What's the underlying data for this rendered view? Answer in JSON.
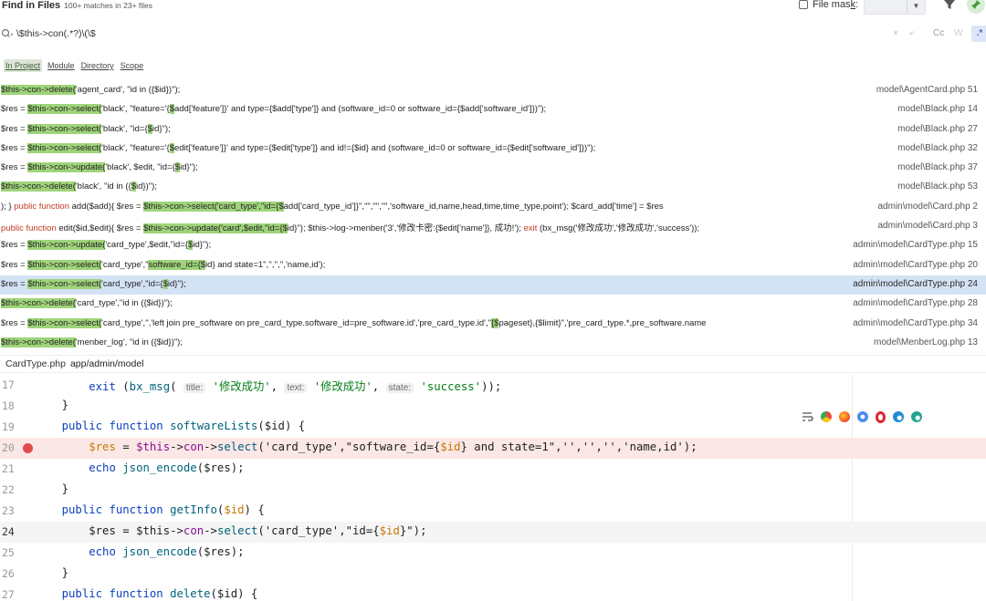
{
  "header": {
    "title": "Find in Files",
    "subtitle": "100+ matches in 23+ files",
    "file_mask_label": "File mas",
    "file_mask_underlined": "k",
    "file_mask_colon": ":"
  },
  "search": {
    "query": "\\$this->con(.*?)\\(\\$",
    "options": [
      "×",
      "⤶",
      "Cc",
      "W"
    ],
    "regex_label": ".*"
  },
  "scopes": [
    "In Project",
    "Module",
    "Directory",
    "Scope"
  ],
  "results": [
    {
      "parts": [
        [
          "hl",
          "$this->con->delete("
        ],
        [
          "",
          "'agent_card', \"id in ({$id})\");"
        ]
      ],
      "file": "model\\AgentCard.php 51"
    },
    {
      "parts": [
        [
          "",
          "$res = "
        ],
        [
          "hl",
          "$this->con->select("
        ],
        [
          "",
          "'black', \"feature='{"
        ],
        [
          "hl",
          "$"
        ],
        [
          "",
          "add['feature']}' and type={$add['type']} and (software_id=0 or software_id={$add['software_id']})\");"
        ]
      ],
      "file": "model\\Black.php 14"
    },
    {
      "parts": [
        [
          "",
          "$res = "
        ],
        [
          "hl",
          "$this->con->select("
        ],
        [
          "",
          "'black', \"id={"
        ],
        [
          "hl",
          "$"
        ],
        [
          "",
          "id}\");"
        ]
      ],
      "file": "model\\Black.php 27"
    },
    {
      "parts": [
        [
          "",
          "$res = "
        ],
        [
          "hl",
          "$this->con->select("
        ],
        [
          "",
          "'black', \"feature='{"
        ],
        [
          "hl",
          "$"
        ],
        [
          "",
          "edit['feature']}' and type={$edit['type']} and id!={$id} and (software_id=0 or software_id={$edit['software_id']})\");"
        ]
      ],
      "file": "model\\Black.php 32"
    },
    {
      "parts": [
        [
          "",
          "$res = "
        ],
        [
          "hl",
          "$this->con->update("
        ],
        [
          "",
          "'black', $edit, \"id={"
        ],
        [
          "hl",
          "$"
        ],
        [
          "",
          "id}\");"
        ]
      ],
      "file": "model\\Black.php 37"
    },
    {
      "parts": [
        [
          "hl",
          "$this->con->delete("
        ],
        [
          "",
          "'black', \"id in ({"
        ],
        [
          "hl",
          "$"
        ],
        [
          "",
          "id})\");"
        ]
      ],
      "file": "model\\Black.php 53"
    },
    {
      "parts": [
        [
          "",
          "); } "
        ],
        [
          "kw",
          "public function "
        ],
        [
          "",
          "add($add){ $res = "
        ],
        [
          "hl",
          "$this->con->select('card_type',\"id={$"
        ],
        [
          "",
          "add['card_type_id']}\",\"\",\"\",\"\",'software_id,name,head,time,time_type,point'); $card_add['time'] = $res"
        ]
      ],
      "file": "admin\\model\\Card.php 2"
    },
    {
      "parts": [
        [
          "kw",
          "public function "
        ],
        [
          "",
          "edit($id,$edit){ $res = "
        ],
        [
          "hl",
          "$this->con->update('card',$edit,\"id={$"
        ],
        [
          "",
          "id}\"); $this->log->menber('3','修改卡密:{$edit['name']}, 成功!'); "
        ],
        [
          "kw",
          "exit "
        ],
        [
          "",
          "(bx_msg('修改成功','修改成功','success'));"
        ]
      ],
      "file": "admin\\model\\Card.php 3"
    },
    {
      "parts": [
        [
          "",
          "$res = "
        ],
        [
          "hl",
          "$this->con->update("
        ],
        [
          "",
          "'card_type',$edit,\"id={"
        ],
        [
          "hl",
          "$"
        ],
        [
          "",
          "id}\");"
        ]
      ],
      "file": "admin\\model\\CardType.php 15"
    },
    {
      "parts": [
        [
          "",
          "$res = "
        ],
        [
          "hl",
          "$this->con->select("
        ],
        [
          "",
          "'card_type',\""
        ],
        [
          "hl",
          "software_id={$"
        ],
        [
          "",
          "id} and state=1\",'','','','name,id');"
        ]
      ],
      "file": "admin\\model\\CardType.php 20"
    },
    {
      "parts": [
        [
          "",
          "$res = "
        ],
        [
          "hl",
          "$this->con->select("
        ],
        [
          "",
          "'card_type',\"id={"
        ],
        [
          "hl",
          "$"
        ],
        [
          "",
          "id}\");"
        ]
      ],
      "file": "admin\\model\\CardType.php 24",
      "selected": true
    },
    {
      "parts": [
        [
          "hl",
          "$this->con->delete("
        ],
        [
          "",
          "'card_type',\"id in ({$id})\");"
        ]
      ],
      "file": "admin\\model\\CardType.php 28"
    },
    {
      "parts": [
        [
          "",
          "$res = "
        ],
        [
          "hl",
          "$this->con->select("
        ],
        [
          "",
          "'card_type','','left join pre_software on pre_card_type.software_id=pre_software.id','pre_card_type.id',\""
        ],
        [
          "hl",
          "{$"
        ],
        [
          "",
          "pageset},{$limit}\",'pre_card_type.*,pre_software.name"
        ]
      ],
      "file": "admin\\model\\CardType.php 34"
    },
    {
      "parts": [
        [
          "hl",
          "$this->con->delete("
        ],
        [
          "",
          "'menber_log', \"id in ({$id})\");"
        ]
      ],
      "file": "model\\MenberLog.php 13"
    }
  ],
  "editor": {
    "file": "CardType.php",
    "path": "app/admin/model",
    "lines": [
      {
        "n": "17",
        "parts": [
          [
            "",
            "        "
          ],
          [
            "k",
            "exit"
          ],
          [
            "",
            " ("
          ],
          [
            "f",
            "bx_msg"
          ],
          [
            "",
            "( "
          ],
          [
            "hint",
            "title:"
          ],
          [
            "",
            " "
          ],
          [
            "s",
            "'修改成功'"
          ],
          [
            "",
            ", "
          ],
          [
            "hint",
            "text:"
          ],
          [
            "",
            " "
          ],
          [
            "s",
            "'修改成功'"
          ],
          [
            "",
            ", "
          ],
          [
            "hint",
            "state:"
          ],
          [
            "",
            " "
          ],
          [
            "s",
            "'success'"
          ],
          [
            "",
            "));"
          ]
        ]
      },
      {
        "n": "18",
        "parts": [
          [
            "",
            "    }"
          ]
        ]
      },
      {
        "n": "19",
        "parts": [
          [
            "",
            "    "
          ],
          [
            "k",
            "public function "
          ],
          [
            "f",
            "softwareLists"
          ],
          [
            "",
            "($id) {"
          ]
        ]
      },
      {
        "n": "20",
        "bp": true,
        "parts": [
          [
            "",
            "        "
          ],
          [
            "v",
            "$res"
          ],
          [
            "",
            " = "
          ],
          [
            "m",
            "$this"
          ],
          [
            "",
            "->"
          ],
          [
            "m",
            "con"
          ],
          [
            "",
            "->"
          ],
          [
            "f",
            "select"
          ],
          [
            "",
            "('card_type',\"software_id={"
          ],
          [
            "v",
            "$id"
          ],
          [
            "",
            "} and state=1\",'','','','name,id');"
          ]
        ]
      },
      {
        "n": "21",
        "parts": [
          [
            "",
            "        "
          ],
          [
            "k",
            "echo "
          ],
          [
            "f",
            "json_encode"
          ],
          [
            "",
            "($res);"
          ]
        ]
      },
      {
        "n": "22",
        "parts": [
          [
            "",
            "    }"
          ]
        ]
      },
      {
        "n": "23",
        "parts": [
          [
            "",
            "    "
          ],
          [
            "k",
            "public function "
          ],
          [
            "f",
            "getInfo"
          ],
          [
            "",
            "("
          ],
          [
            "v",
            "$id"
          ],
          [
            "",
            ") {"
          ]
        ]
      },
      {
        "n": "24",
        "cur": true,
        "parts": [
          [
            "",
            "        "
          ],
          [
            "",
            "$res"
          ],
          [
            "",
            " = "
          ],
          [
            "",
            "$this"
          ],
          [
            "",
            "->"
          ],
          [
            "m",
            "con"
          ],
          [
            "",
            "->"
          ],
          [
            "f",
            "select"
          ],
          [
            "",
            "('card_type',\"id={"
          ],
          [
            "v",
            "$id"
          ],
          [
            "",
            "}\");"
          ]
        ]
      },
      {
        "n": "25",
        "parts": [
          [
            "",
            "        "
          ],
          [
            "k",
            "echo "
          ],
          [
            "f",
            "json_encode"
          ],
          [
            "",
            "($res);"
          ]
        ]
      },
      {
        "n": "26",
        "parts": [
          [
            "",
            "    }"
          ]
        ]
      },
      {
        "n": "27",
        "parts": [
          [
            "",
            "    "
          ],
          [
            "k",
            "public function "
          ],
          [
            "f",
            "delete"
          ],
          [
            "",
            "($id) {"
          ]
        ]
      }
    ]
  },
  "colors": {
    "match_highlight": "#9fd47a",
    "selected_row": "#d4e2f5",
    "breakpoint_line": "#fbe7e6",
    "breakpoint_dot": "#e34a4a"
  },
  "floating_toolbar": [
    "wrap-icon",
    "chrome-icon",
    "firefox-icon",
    "chromium-icon",
    "opera-icon",
    "edge-icon",
    "edge-dev-icon"
  ]
}
